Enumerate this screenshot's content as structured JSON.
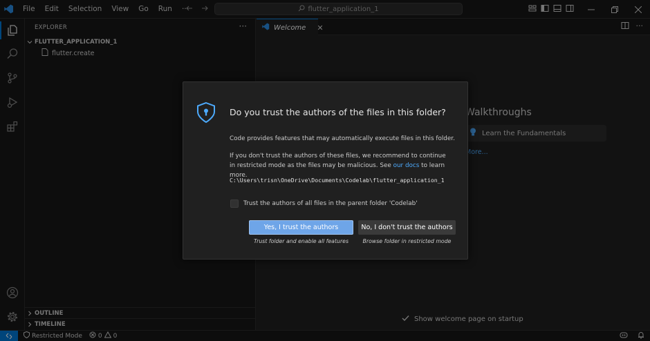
{
  "titlebar": {
    "menu": [
      "File",
      "Edit",
      "Selection",
      "View",
      "Go",
      "Run",
      "···"
    ],
    "search_text": "flutter_application_1"
  },
  "sidebar": {
    "title": "EXPLORER",
    "more": "···",
    "folder": "FLUTTER_APPLICATION_1",
    "file": "flutter.create",
    "outline": "OUTLINE",
    "timeline": "TIMELINE"
  },
  "editor": {
    "tab_label": "Welcome",
    "walkthroughs_title": "Walkthroughs",
    "walkthrough_item": "Learn the Fundamentals",
    "more_link": "More...",
    "show_welcome": "Show welcome page on startup"
  },
  "dialog": {
    "title": "Do you trust the authors of the files in this folder?",
    "paragraph1": "Code provides features that may automatically execute files in this folder.",
    "paragraph2_before": "If you don't trust the authors of these files, we recommend to continue in restricted mode as the files may be malicious. See ",
    "paragraph2_link": "our docs",
    "paragraph2_after": " to learn more.",
    "path": "C:\\Users\\trisn\\OneDrive\\Documents\\Codelab\\flutter_application_1",
    "checkbox_label": "Trust the authors of all files in the parent folder 'Codelab'",
    "checkbox_checked": false,
    "yes_button": "Yes, I trust the authors",
    "yes_caption": "Trust folder and enable all features",
    "no_button": "No, I don't trust the authors",
    "no_caption": "Browse folder in restricted mode"
  },
  "statusbar": {
    "restricted_mode": "Restricted Mode",
    "errors": "0",
    "warnings": "0"
  },
  "colors": {
    "accent": "#0078d4",
    "primary_button": "#6ea5e8",
    "link": "#4daafc",
    "shield": "#4daafc"
  }
}
